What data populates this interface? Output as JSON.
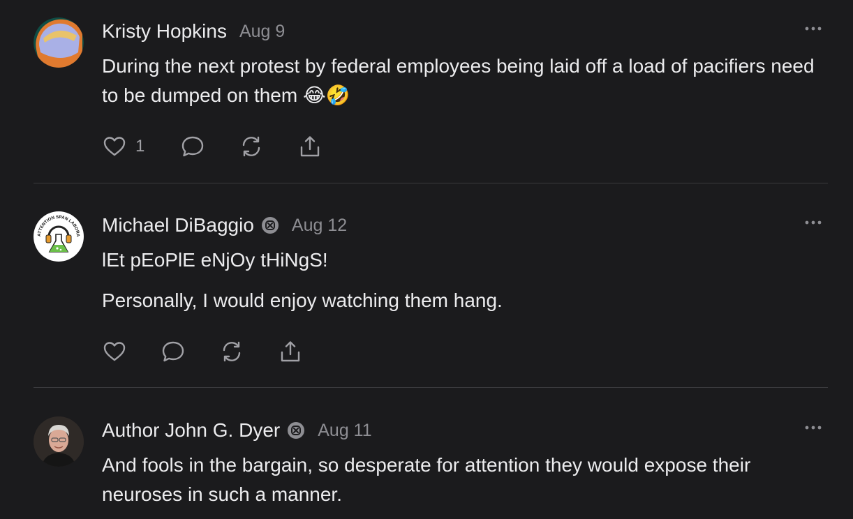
{
  "comments": [
    {
      "author": "Kristy Hopkins",
      "date": "Aug 9",
      "paragraphs": [
        "During the next protest by federal employees being laid off a load of pacifiers need to be dumped on them 😂🤣"
      ],
      "like_count": "1",
      "badge": false,
      "avatar": "abstract-gradient-avatar"
    },
    {
      "author": "Michael DiBaggio",
      "date": "Aug 12",
      "paragraphs": [
        "lEt pEoPlE eNjOy tHiNgS!",
        "Personally, I would enjoy watching them hang."
      ],
      "like_count": "",
      "badge": true,
      "avatar": "attention-span-laboratories-logo",
      "avatar_logo_text": "ATTENTION SPAN LABORATORIES"
    },
    {
      "author": "Author John G. Dyer",
      "date": "Aug 11",
      "paragraphs": [
        "And fools in the bargain, so desperate for attention they would expose their neuroses in such a manner."
      ],
      "like_count": "",
      "badge": true,
      "avatar": "user-photo-avatar"
    }
  ],
  "colors": {
    "background": "#1b1b1d",
    "text": "#ececee",
    "muted": "#8e8e93",
    "divider": "#3a3a3d",
    "icon": "#a1a1a6"
  },
  "icons": [
    "heart-icon",
    "comment-icon",
    "restack-icon",
    "share-icon",
    "more-icon",
    "badge-icon"
  ]
}
